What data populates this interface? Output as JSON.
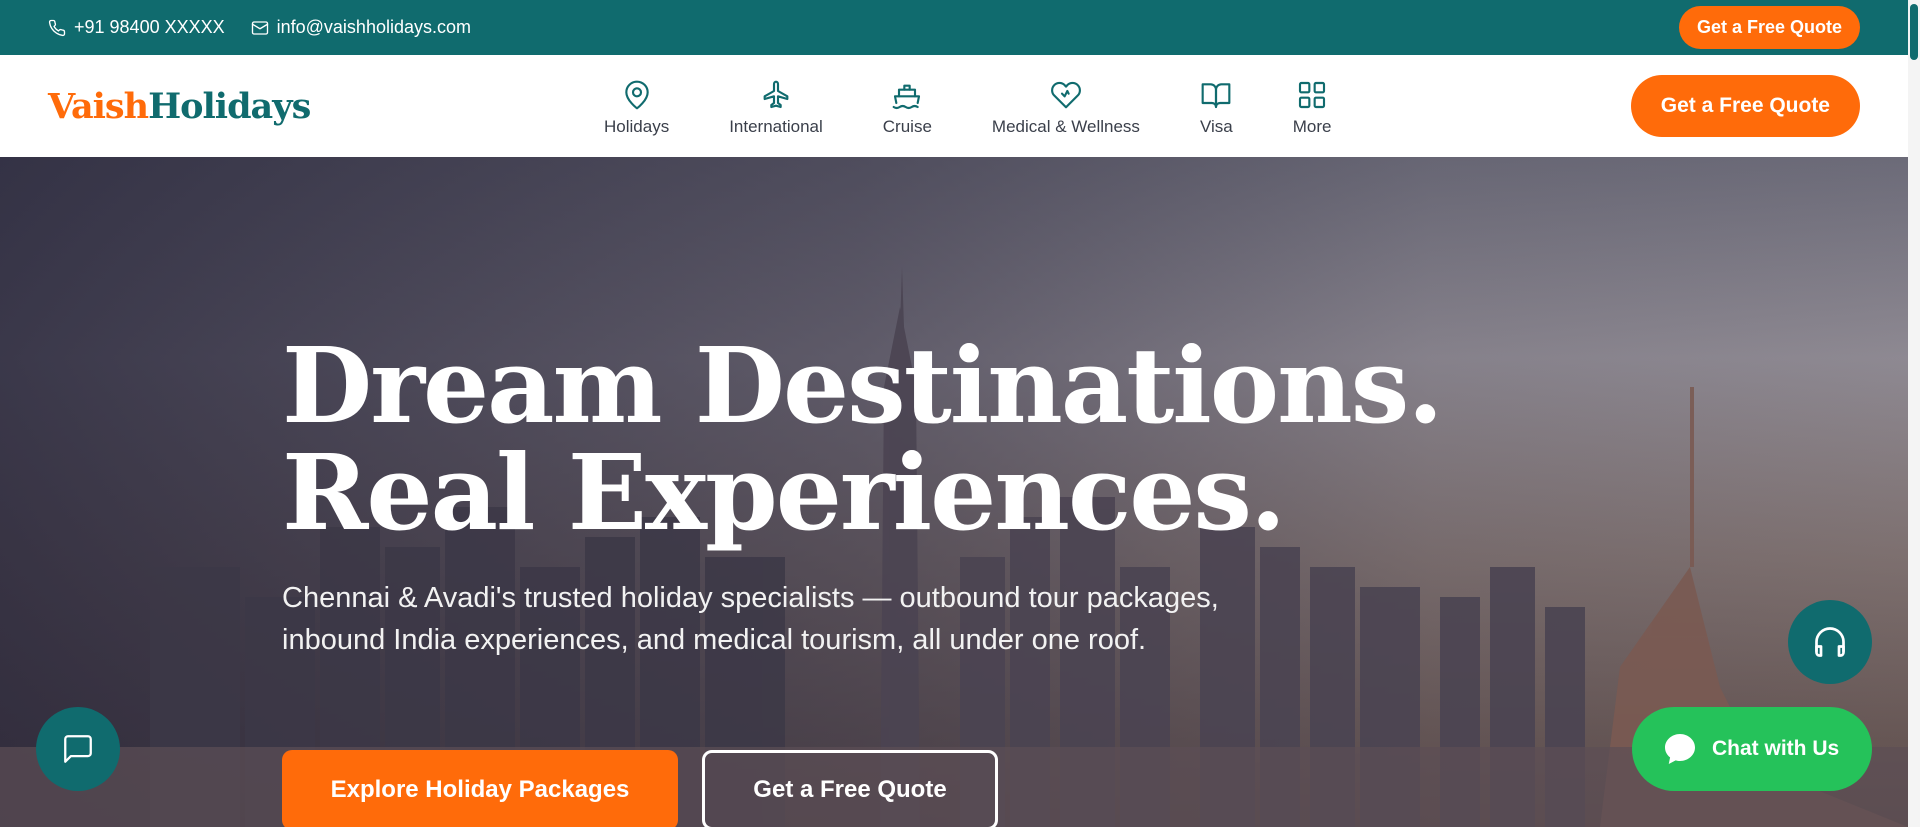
{
  "topbar": {
    "phone": "+91 98400 XXXXX",
    "email": "info@vaishholidays.com",
    "quote_label": "Get a Free Quote"
  },
  "nav": {
    "logo_part1": "Vaish",
    "logo_part2": "Holidays",
    "items": [
      {
        "label": "Holidays",
        "icon": "map-pin-icon"
      },
      {
        "label": "International",
        "icon": "plane-icon"
      },
      {
        "label": "Cruise",
        "icon": "ship-icon"
      },
      {
        "label": "Medical & Wellness",
        "icon": "heart-pulse-icon"
      },
      {
        "label": "Visa",
        "icon": "book-open-icon"
      },
      {
        "label": "More",
        "icon": "grid-icon"
      }
    ],
    "quote_label": "Get a Free Quote"
  },
  "hero": {
    "title_line1": "Dream Destinations.",
    "title_line2": "Real Experiences.",
    "subtitle": "Chennai & Avadi's trusted holiday specialists — outbound tour packages, inbound India experiences, and medical tourism, all under one roof.",
    "primary_cta": "Explore Holiday Packages",
    "secondary_cta": "Get a Free Quote"
  },
  "floating": {
    "chat_label": "Chat with Us"
  },
  "colors": {
    "teal": "#106b6e",
    "orange": "#ff6b0a",
    "green": "#25c25a"
  }
}
